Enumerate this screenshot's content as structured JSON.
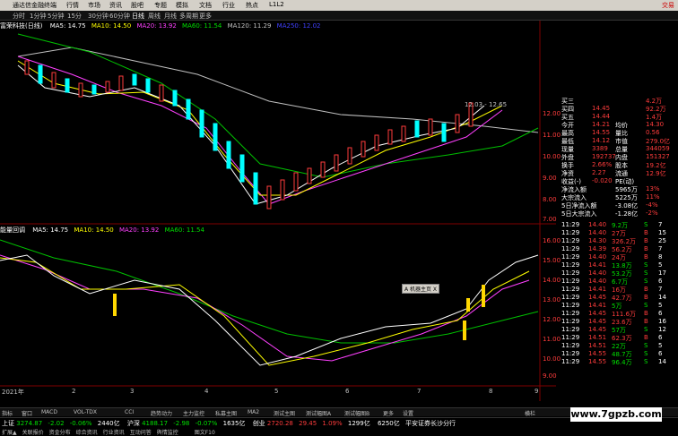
{
  "titlebar": {
    "title": "通达信金融终端",
    "menus": [
      "行情",
      "市场",
      "资讯",
      "股吧",
      "专题",
      "模拟",
      "文档",
      "行业",
      "热点",
      "L1L2"
    ],
    "right": "交易"
  },
  "tabs": [
    "分时",
    "1分钟",
    "5分钟",
    "15分",
    "30分钟",
    "60分钟",
    "日线",
    "周线",
    "月线",
    "多周期",
    "更多"
  ],
  "active_tab": "日线",
  "main_legend": {
    "title": "富荣科技(日线)",
    "ma5": "MA5: 14.75",
    "ma10": "MA10: 14.50",
    "ma20": "MA20: 13.92",
    "ma60": "MA60: 11.54",
    "ma120": "MA120: 11.29",
    "ma250": "MA250: 12.02"
  },
  "sub_legend": {
    "title": "能量回调",
    "ma5": "MA5: 14.75",
    "ma10": "MA10: 14.50",
    "ma20": "MA20: 13.92",
    "ma60": "MA60: 11.54"
  },
  "annot": "12.03 - 12.65",
  "popup": "A 机器主页 X",
  "main_axis": [
    "12.00",
    "11.00",
    "10.00",
    "9.00",
    "8.00",
    "7.00"
  ],
  "sub_axis": [
    "16.00",
    "15.00",
    "14.00",
    "13.00",
    "12.00",
    "11.00",
    "10.00",
    "9.00",
    "8.00"
  ],
  "date_axis": [
    "2021年",
    "2",
    "3",
    "4",
    "5",
    "6",
    "7",
    "8",
    "9"
  ],
  "quote": {
    "rows": [
      {
        "label": "买三",
        "v1": "",
        "v2": "4.2万"
      },
      {
        "label": "买四",
        "v1": "14.45",
        "v2": "92.2万"
      },
      {
        "label": "买五",
        "v1": "14.44",
        "v2": "1.4万"
      },
      {
        "label": "今开",
        "v1": "14.21",
        "l2": "均价",
        "v2": "14.30"
      },
      {
        "label": "最高",
        "v1": "14.55",
        "l2": "量比",
        "v2": "0.56"
      },
      {
        "label": "最低",
        "v1": "14.12",
        "l2": "市值",
        "v2": "279.0亿"
      },
      {
        "label": "现量",
        "v1": "3389",
        "l2": "总量",
        "v2": "344059"
      },
      {
        "label": "外盘",
        "v1": "192737",
        "l2": "内盘",
        "v2": "151327"
      },
      {
        "label": "换手",
        "v1": "2.66%",
        "l2": "股本",
        "v2": "19.2亿"
      },
      {
        "label": "净资",
        "v1": "2.27",
        "l2": "流通",
        "v2": "12.9亿"
      },
      {
        "label": "收益(-)",
        "v1": "-0.020",
        "l2": "PE(动)",
        "v2": ""
      },
      {
        "label": "净流入额",
        "v1": "",
        "l2": "5965万",
        "v2": "13%"
      },
      {
        "label": "大宗流入",
        "v1": "",
        "l2": "5225万",
        "v2": "11%"
      },
      {
        "label": "5日净流入额",
        "v1": "",
        "l2": "-3.08亿",
        "v2": "-4%"
      },
      {
        "label": "5日大宗流入",
        "v1": "",
        "l2": "-1.28亿",
        "v2": "-2%"
      }
    ]
  },
  "ticks": [
    {
      "t": "11:29",
      "p": "14.40",
      "v": "9.2万",
      "s": "S",
      "c": "7"
    },
    {
      "t": "11:29",
      "p": "14.40",
      "v": "27万",
      "s": "B",
      "c": "15"
    },
    {
      "t": "11:29",
      "p": "14.30",
      "v": "326.2万",
      "s": "B",
      "c": "25"
    },
    {
      "t": "11:29",
      "p": "14.39",
      "v": "56.2万",
      "s": "B",
      "c": "7"
    },
    {
      "t": "11:29",
      "p": "14.40",
      "v": "24万",
      "s": "B",
      "c": "8"
    },
    {
      "t": "11:29",
      "p": "14.41",
      "v": "13.8万",
      "s": "S",
      "c": "5"
    },
    {
      "t": "11:29",
      "p": "14.40",
      "v": "53.2万",
      "s": "S",
      "c": "17"
    },
    {
      "t": "11:29",
      "p": "14.40",
      "v": "6.7万",
      "s": "S",
      "c": "6"
    },
    {
      "t": "11:29",
      "p": "14.41",
      "v": "16万",
      "s": "B",
      "c": "7"
    },
    {
      "t": "11:29",
      "p": "14.45",
      "v": "42.7万",
      "s": "B",
      "c": "14"
    },
    {
      "t": "11:29",
      "p": "14.41",
      "v": "5万",
      "s": "S",
      "c": "5"
    },
    {
      "t": "11:29",
      "p": "14.45",
      "v": "111.6万",
      "s": "B",
      "c": "6"
    },
    {
      "t": "11:29",
      "p": "14.45",
      "v": "23.6万",
      "s": "B",
      "c": "16"
    },
    {
      "t": "11:29",
      "p": "14.45",
      "v": "57万",
      "s": "S",
      "c": "12"
    },
    {
      "t": "11:29",
      "p": "14.51",
      "v": "62.3万",
      "s": "B",
      "c": "6"
    },
    {
      "t": "11:29",
      "p": "14.51",
      "v": "22万",
      "s": "S",
      "c": "5"
    },
    {
      "t": "11:29",
      "p": "14.55",
      "v": "48.7万",
      "s": "S",
      "c": "6"
    },
    {
      "t": "11:29",
      "p": "14.55",
      "v": "96.4万",
      "s": "S",
      "c": "14"
    }
  ],
  "bottom_tabs": [
    "指标",
    "窗口",
    "MACD",
    "VOL-TDX",
    "CCI",
    "趋势动力",
    "主力监控",
    "私募主图",
    "MA2",
    "测试主图",
    "测试幅图A",
    "测试幅图B",
    "更多",
    "设置"
  ],
  "status": {
    "sh_label": "上证",
    "sh_val": "3274.87",
    "sh_chg": "-2.02",
    "sh_pct": "-0.06%",
    "sh_amt": "2440亿",
    "sz_label": "沪深",
    "sz_val": "4188.17",
    "sz_chg": "-2.98",
    "sz_pct": "-0.07%",
    "sz_amt": "1635亿",
    "cy_label": "创业",
    "cy_val": "2720.28",
    "cy_chg": "29.45",
    "cy_pct": "1.09%",
    "cy_amt": "1299亿",
    "extra": "6250亿",
    "news": "平安证券长沙分行",
    "links": [
      "扩展▲",
      "关联报价",
      "资金分布",
      "综合资讯",
      "行业资讯",
      "互动问答",
      "舆情监控",
      "",
      "",
      "图文F10"
    ]
  },
  "watermark": "www.7gpzb.com",
  "fold_label": "横栏"
}
